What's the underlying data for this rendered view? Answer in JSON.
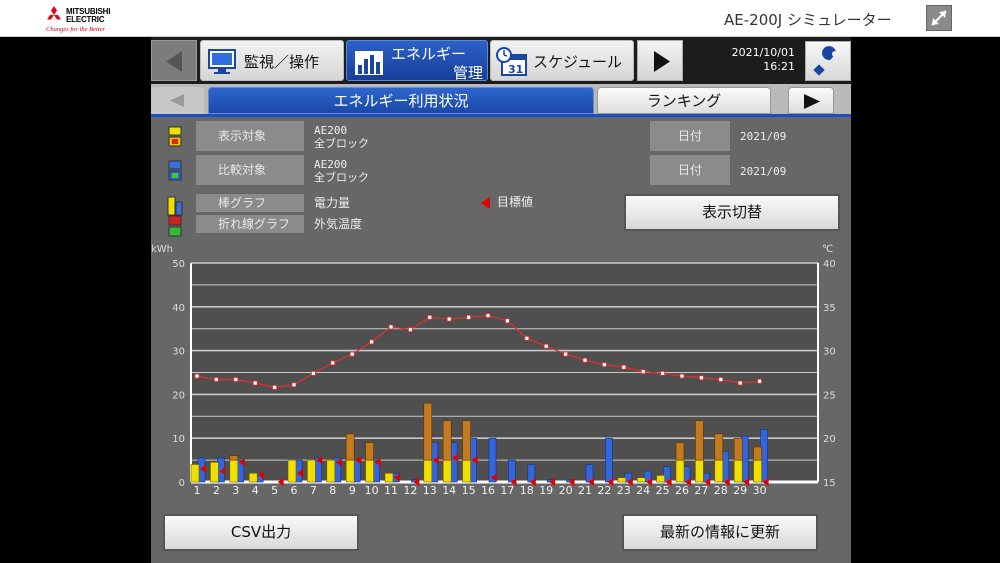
{
  "header": {
    "brand_line1": "MITSUBISHI",
    "brand_line2": "ELECTRIC",
    "tagline": "Changes for the Better",
    "app_title": "AE-200J シミュレーター",
    "expand_icon": "expand-arrows-icon"
  },
  "nav": {
    "tabs": [
      {
        "label": "監視／操作",
        "icon": "monitor-icon"
      },
      {
        "label_line1": "エネルギー",
        "label_line2": "管理",
        "icon": "bar-chart-icon"
      },
      {
        "label": "スケジュール",
        "icon": "calendar-clock-icon"
      }
    ],
    "date": "2021/10/01",
    "time": "16:21",
    "settings_icon": "wrench-icon"
  },
  "subtabs": {
    "active": "エネルギー利用状況",
    "other": "ランキング"
  },
  "info": {
    "display_target_label": "表示対象",
    "display_target_value_line1": "AE200",
    "display_target_value_line2": "全ブロック",
    "compare_target_label": "比較対象",
    "compare_target_value_line1": "AE200",
    "compare_target_value_line2": "全ブロック",
    "date_label": "日付",
    "display_date": "2021/09",
    "compare_date": "2021/09",
    "bar_graph_label": "棒グラフ",
    "bar_graph_value": "電力量",
    "line_graph_label": "折れ線グラフ",
    "line_graph_value": "外気温度",
    "target_label": "目標値",
    "toggle_button": "表示切替"
  },
  "footer": {
    "csv_button": "CSV出力",
    "refresh_button": "最新の情報に更新"
  },
  "colors": {
    "display_bar": "#f0e000",
    "compare_bar": "#3366dd",
    "display_overflow": "#c47a1e",
    "line": "#e03030",
    "target": "#e00000"
  },
  "chart_data": {
    "type": "bar",
    "y_unit_left": "kWh",
    "y_unit_right": "℃",
    "ylim_left": [
      0,
      50
    ],
    "ylim_right": [
      15,
      40
    ],
    "y_ticks_left": [
      0,
      10,
      20,
      30,
      40,
      50
    ],
    "y_ticks_right": [
      15,
      20,
      25,
      30,
      35,
      40
    ],
    "categories": [
      "1",
      "2",
      "3",
      "4",
      "5",
      "6",
      "7",
      "8",
      "9",
      "10",
      "11",
      "12",
      "13",
      "14",
      "15",
      "16",
      "17",
      "18",
      "19",
      "20",
      "21",
      "22",
      "23",
      "24",
      "25",
      "26",
      "27",
      "28",
      "29",
      "30"
    ],
    "series": [
      {
        "name": "電力量",
        "values": [
          4,
          4.5,
          6,
          2,
          0,
          5,
          5,
          5,
          11,
          9,
          2,
          0,
          18,
          14,
          14,
          0,
          0,
          0,
          0,
          0,
          0,
          0,
          1,
          1,
          1.5,
          9,
          14,
          11,
          10,
          8
        ]
      },
      {
        "name": "比較",
        "values": [
          5.5,
          5.5,
          5,
          1.5,
          0,
          5,
          5.5,
          5.5,
          5,
          5,
          2,
          0.5,
          9,
          9,
          10,
          10,
          5,
          4,
          0.5,
          0.5,
          4,
          10,
          2,
          2.5,
          3.5,
          3.5,
          2,
          7,
          10.5,
          12
        ]
      },
      {
        "name": "外気温度",
        "values": [
          27.1,
          26.7,
          26.7,
          26.3,
          25.8,
          26.1,
          27.4,
          28.6,
          29.6,
          31.0,
          32.7,
          32.4,
          33.8,
          33.6,
          33.8,
          34.0,
          33.4,
          31.4,
          30.5,
          29.6,
          28.9,
          28.4,
          28.1,
          27.6,
          27.4,
          27.1,
          26.9,
          26.7,
          26.3,
          26.5
        ]
      }
    ],
    "target_values": [
      3,
      2.5,
      4.5,
      1.5,
      0,
      2,
      5,
      4.5,
      5,
      4.5,
      1,
      0,
      5,
      5.5,
      5,
      1,
      0,
      0,
      0,
      0,
      0,
      0,
      0,
      0,
      0,
      0,
      0,
      0,
      0,
      0
    ],
    "grid": true
  }
}
